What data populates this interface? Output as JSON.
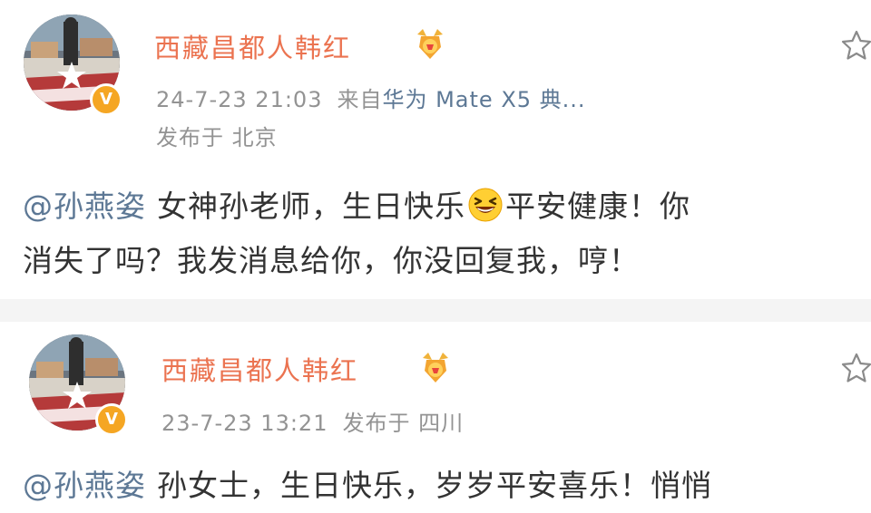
{
  "posts": [
    {
      "username": "西藏昌都人韩红",
      "timestamp": "24-7-23 21:03",
      "source_prefix": "来自",
      "source": "华为 Mate X5 典...",
      "location": "发布于 北京",
      "mention": "@孙燕姿",
      "text_part1": "女神孙老师，生日快乐",
      "emoji": "grinning-squinting-face",
      "text_part2": "平安健康！你",
      "text_line2": "消失了吗？我发消息给你，你没回复我，哼！",
      "verified_badge": "V",
      "medal_icon": "gold-medal-icon",
      "star_icon": "star-outline-icon"
    },
    {
      "username": "西藏昌都人韩红",
      "timestamp": "23-7-23 13:21",
      "location": "发布于 四川",
      "mention": "@孙燕姿",
      "text_part1": "孙女士，生日快乐，岁岁平安喜乐！悄悄",
      "verified_badge": "V",
      "medal_icon": "gold-medal-icon",
      "star_icon": "star-outline-icon"
    }
  ],
  "colors": {
    "username": "#eb7350",
    "mention": "#5d7895",
    "meta": "#939393",
    "body_text": "#333333",
    "verified": "#f5a623",
    "divider": "#f4f4f4"
  }
}
